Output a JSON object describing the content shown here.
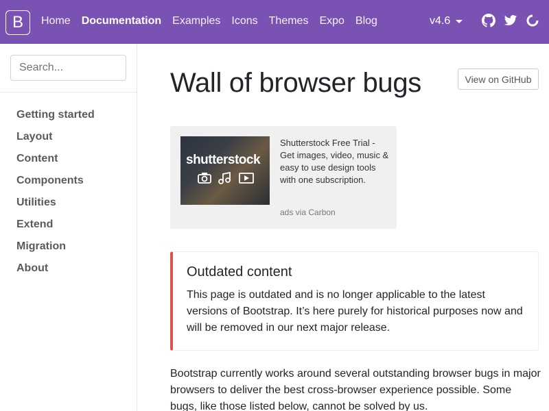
{
  "navbar": {
    "brand": "B",
    "links": [
      "Home",
      "Documentation",
      "Examples",
      "Icons",
      "Themes",
      "Expo",
      "Blog"
    ],
    "active": "Documentation",
    "version": "v4.6",
    "accent_color": "#7952b3",
    "icons": [
      "github-icon",
      "twitter-icon",
      "slack-icon"
    ]
  },
  "sidebar": {
    "search_placeholder": "Search...",
    "items": [
      {
        "label": "Getting started"
      },
      {
        "label": "Layout"
      },
      {
        "label": "Content"
      },
      {
        "label": "Components"
      },
      {
        "label": "Utilities"
      },
      {
        "label": "Extend"
      },
      {
        "label": "Migration"
      },
      {
        "label": "About"
      }
    ]
  },
  "main": {
    "title": "Wall of browser bugs",
    "github_button": "View on GitHub",
    "carbon": {
      "image_text": "shutterstock",
      "text": "Shutterstock Free Trial - Get images, video, music & easy to use design tools with one subscription.",
      "powered_by": "ads via Carbon"
    },
    "callout": {
      "title": "Outdated content",
      "text": "This page is outdated and is no longer applicable to the latest versions of Bootstrap. It’s here purely for historical purposes now and will be removed in our next major release.",
      "border_color": "#d9534f"
    },
    "lead": "Bootstrap currently works around several outstanding browser bugs in major browsers to deliver the best cross-browser experience possible. Some bugs, like those listed below, cannot be solved by us."
  }
}
